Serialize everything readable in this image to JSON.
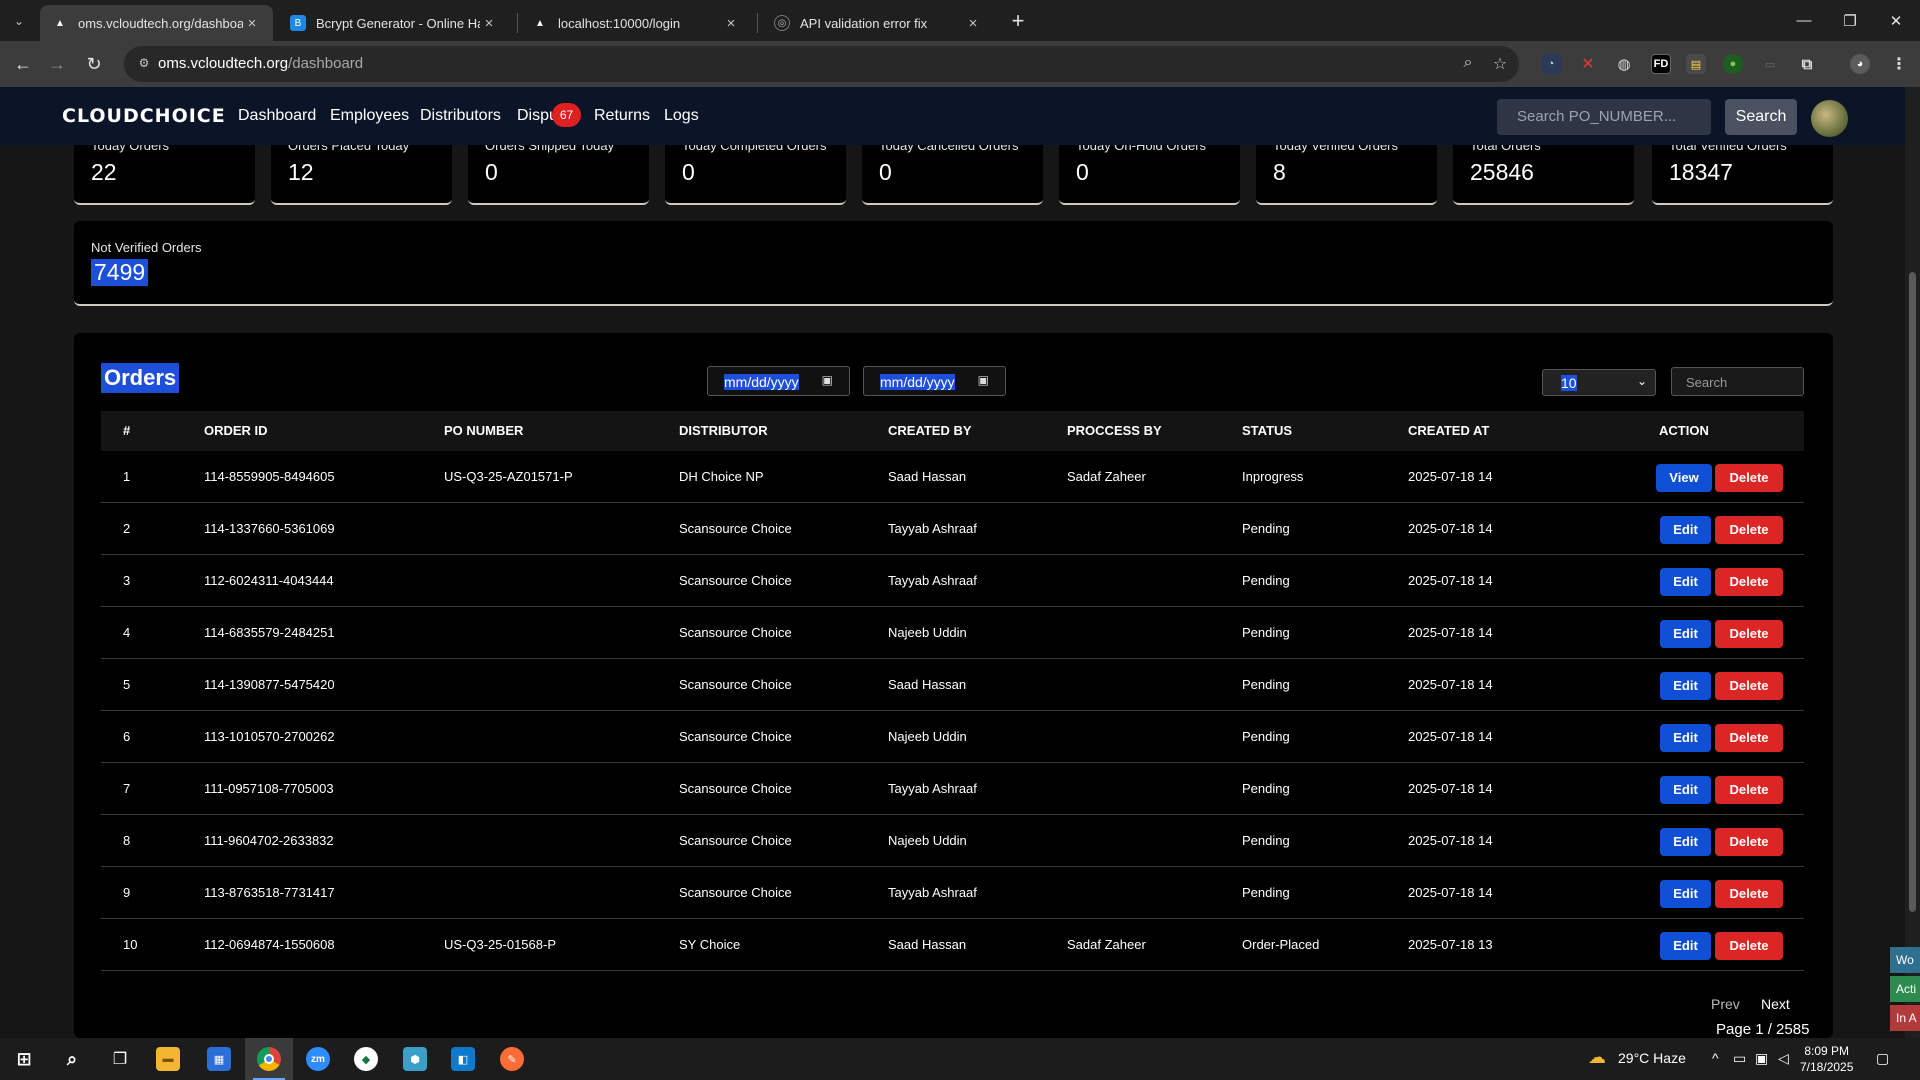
{
  "browser": {
    "tabs": [
      {
        "title": "oms.vcloudtech.org/dashboard",
        "active": true
      },
      {
        "title": "Bcrypt Generator - Online Hash",
        "active": false
      },
      {
        "title": "localhost:10000/login",
        "active": false
      },
      {
        "title": "API validation error fix",
        "active": false
      }
    ],
    "url_host": "oms.vcloudtech.org",
    "url_path": "/dashboard"
  },
  "app": {
    "logo": "CLOUDCHOICE",
    "menu": [
      "Dashboard",
      "Employees",
      "Distributors",
      "Dispu",
      "Returns",
      "Logs"
    ],
    "disputes_badge": "67",
    "search_placeholder": "Search PO_NUMBER...",
    "search_button": "Search"
  },
  "stats": [
    {
      "label": "Today Orders",
      "value": "22"
    },
    {
      "label": "Orders Placed Today",
      "value": "12"
    },
    {
      "label": "Orders Shipped Today",
      "value": "0"
    },
    {
      "label": "Today Completed Orders",
      "value": "0"
    },
    {
      "label": "Today Cancelled Orders",
      "value": "0"
    },
    {
      "label": "Today On-Hold Orders",
      "value": "0"
    },
    {
      "label": "Today Verified Orders",
      "value": "8"
    },
    {
      "label": "Total Orders",
      "value": "25846"
    },
    {
      "label": "Total Verified Orders",
      "value": "18347"
    }
  ],
  "not_verified": {
    "label": "Not Verified Orders",
    "value": "7499"
  },
  "orders": {
    "title": "Orders",
    "date_from": "mm/dd/yyyy",
    "date_to": "mm/dd/yyyy",
    "page_size": "10",
    "search_placeholder": "Search",
    "headers": [
      "#",
      "ORDER ID",
      "PO NUMBER",
      "DISTRIBUTOR",
      "CREATED BY",
      "PROCCESS BY",
      "STATUS",
      "CREATED AT",
      "ACTION"
    ],
    "rows": [
      {
        "n": "1",
        "order_id": "114-8559905-8494605",
        "po": "US-Q3-25-AZ01571-P",
        "distributor": "DH Choice NP",
        "created_by": "Saad Hassan",
        "process_by": "Sadaf Zaheer",
        "status": "Inprogress",
        "created_at": "2025-07-18 14",
        "primary": "View",
        "secondary": "Delete"
      },
      {
        "n": "2",
        "order_id": "114-1337660-5361069",
        "po": "",
        "distributor": "Scansource Choice",
        "created_by": "Tayyab Ashraaf",
        "process_by": "",
        "status": "Pending",
        "created_at": "2025-07-18 14",
        "primary": "Edit",
        "secondary": "Delete"
      },
      {
        "n": "3",
        "order_id": "112-6024311-4043444",
        "po": "",
        "distributor": "Scansource Choice",
        "created_by": "Tayyab Ashraaf",
        "process_by": "",
        "status": "Pending",
        "created_at": "2025-07-18 14",
        "primary": "Edit",
        "secondary": "Delete"
      },
      {
        "n": "4",
        "order_id": "114-6835579-2484251",
        "po": "",
        "distributor": "Scansource Choice",
        "created_by": "Najeeb Uddin",
        "process_by": "",
        "status": "Pending",
        "created_at": "2025-07-18 14",
        "primary": "Edit",
        "secondary": "Delete"
      },
      {
        "n": "5",
        "order_id": "114-1390877-5475420",
        "po": "",
        "distributor": "Scansource Choice",
        "created_by": "Saad Hassan",
        "process_by": "",
        "status": "Pending",
        "created_at": "2025-07-18 14",
        "primary": "Edit",
        "secondary": "Delete"
      },
      {
        "n": "6",
        "order_id": "113-1010570-2700262",
        "po": "",
        "distributor": "Scansource Choice",
        "created_by": "Najeeb Uddin",
        "process_by": "",
        "status": "Pending",
        "created_at": "2025-07-18 14",
        "primary": "Edit",
        "secondary": "Delete"
      },
      {
        "n": "7",
        "order_id": "111-0957108-7705003",
        "po": "",
        "distributor": "Scansource Choice",
        "created_by": "Tayyab Ashraaf",
        "process_by": "",
        "status": "Pending",
        "created_at": "2025-07-18 14",
        "primary": "Edit",
        "secondary": "Delete"
      },
      {
        "n": "8",
        "order_id": "111-9604702-2633832",
        "po": "",
        "distributor": "Scansource Choice",
        "created_by": "Najeeb Uddin",
        "process_by": "",
        "status": "Pending",
        "created_at": "2025-07-18 14",
        "primary": "Edit",
        "secondary": "Delete"
      },
      {
        "n": "9",
        "order_id": "113-8763518-7731417",
        "po": "",
        "distributor": "Scansource Choice",
        "created_by": "Tayyab Ashraaf",
        "process_by": "",
        "status": "Pending",
        "created_at": "2025-07-18 14",
        "primary": "Edit",
        "secondary": "Delete"
      },
      {
        "n": "10",
        "order_id": "112-0694874-1550608",
        "po": "US-Q3-25-01568-P",
        "distributor": "SY Choice",
        "created_by": "Saad Hassan",
        "process_by": "Sadaf Zaheer",
        "status": "Order-Placed",
        "created_at": "2025-07-18 13",
        "primary": "Edit",
        "secondary": "Delete"
      }
    ],
    "prev": "Prev",
    "next": "Next",
    "page_info": "Page 1 / 2585"
  },
  "side_tabs": [
    {
      "label": "Wo",
      "color": "#2f6f8f"
    },
    {
      "label": "Acti",
      "color": "#2e8b4f"
    },
    {
      "label": "In A",
      "color": "#b23a3a"
    }
  ],
  "taskbar": {
    "weather": "29°C  Haze",
    "time": "8:09 PM",
    "date": "7/18/2025"
  }
}
